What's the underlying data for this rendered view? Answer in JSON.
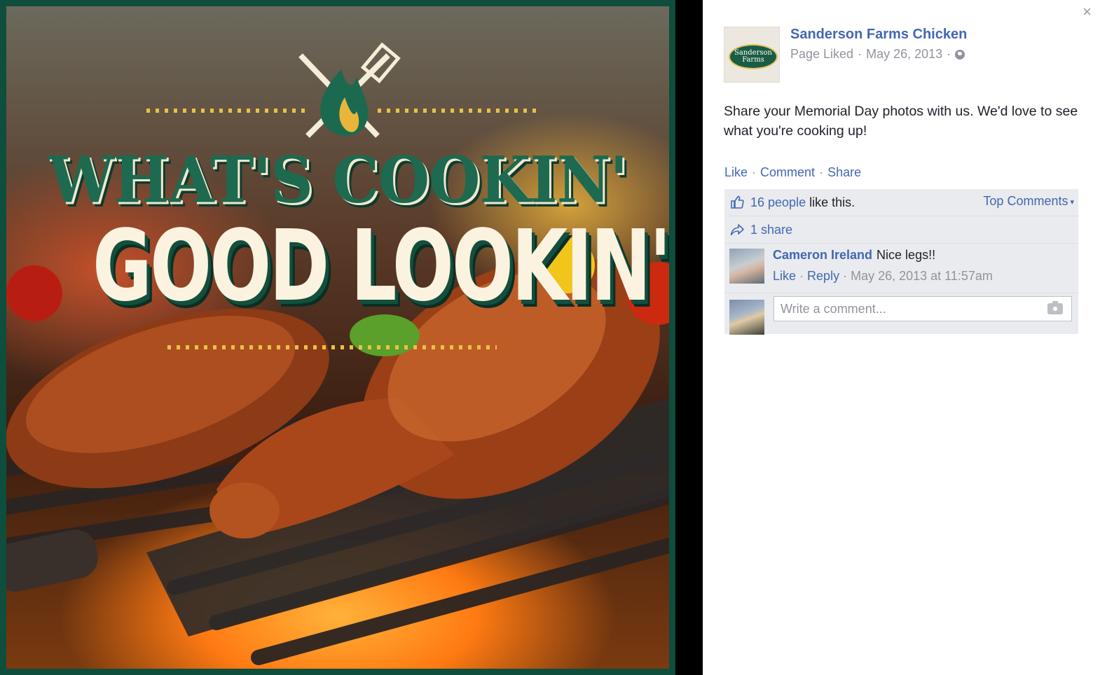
{
  "photo": {
    "headline_line1": "WHAT'S COOKIN'",
    "headline_line2": "GOOD LOOKIN' ?"
  },
  "post": {
    "page_name": "Sanderson Farms Chicken",
    "page_status": "Page Liked",
    "date": "May 26, 2013",
    "avatar_logo_text": "Sanderson Farms",
    "text": "Share your Memorial Day photos with us. We'd love to see what you're cooking up!",
    "actions": {
      "like": "Like",
      "comment": "Comment",
      "share": "Share"
    }
  },
  "feedback": {
    "likes_count": "16 people",
    "likes_tail": "like this.",
    "top_comments": "Top Comments",
    "shares": "1 share"
  },
  "comments": [
    {
      "author": "Cameron Ireland",
      "text": "Nice legs!!",
      "like": "Like",
      "reply": "Reply",
      "timestamp": "May 26, 2013 at 11:57am"
    }
  ],
  "composer": {
    "placeholder": "Write a comment..."
  },
  "colors": {
    "link": "#4267b2",
    "brand_green": "#0f4d3c",
    "meta_grey": "#90949c"
  }
}
